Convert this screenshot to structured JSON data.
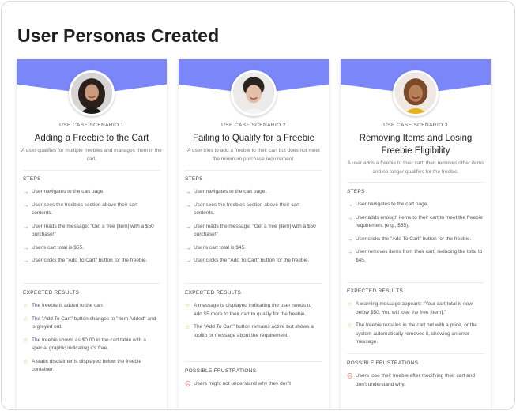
{
  "page": {
    "title": "User Personas Created"
  },
  "colors": {
    "banner": "#7b86f8",
    "step_arrow": "#3f8ee0",
    "star": "#f0b23c",
    "frustration": "#e05a4f"
  },
  "icons": {
    "step": "arrow-right-icon",
    "expected": "star-icon",
    "frustration": "sad-face-icon"
  },
  "cards": [
    {
      "label": "USE CASE SCENARIO 1",
      "title": "Adding a Freebie to the Cart",
      "description": "A user qualifies for multiple freebies and manages them in the cart.",
      "steps_heading": "STEPS",
      "steps": [
        "User navigates to the cart page.",
        "User sees the freebies section above their cart contents.",
        "User reads the message: \"Get a free [item] with a $50 purchase!\"",
        "User's cart total is $55.",
        "User clicks the \"Add To Cart\" button for the freebie."
      ],
      "expected_heading": "EXPECTED RESULTS",
      "expected": [
        "The freebie is added to the cart",
        "The \"Add To Cart\" button changes to \"Item Added\" and is greyed out.",
        "The freebie shows as $0.00 in the cart table with a special graphic indicating it's free.",
        "A static disclaimer is displayed below the freebie container."
      ]
    },
    {
      "label": "USE CASE SCENARIO 2",
      "title": "Failing to Qualify for a Freebie",
      "description": "A user tries to add a freebie to their cart but does not meet the minimum purchase requirement.",
      "steps_heading": "STEPS",
      "steps": [
        "User navigates to the cart page.",
        "User sees the freebies section above their cart contents.",
        "User reads the message: \"Get a free [item] with a $50 purchase!\"",
        "User's cart total is $45.",
        "User clicks the \"Add To Cart\" button for the freebie."
      ],
      "expected_heading": "EXPECTED RESULTS",
      "expected": [
        "A message is displayed indicating the user needs to add $5 more to their cart to qualify for the freebie.",
        "The \"Add To Cart\" button remains active but shows a tooltip or message about the requirement."
      ],
      "frustrations_heading": "POSSIBLE FRUSTRATIONS",
      "frustrations": [
        "Users might not understand why they don't"
      ]
    },
    {
      "label": "USE CASE SCENARIO 3",
      "title": "Removing Items and Losing Freebie Eligibility",
      "description": "A user adds a freebie to their cart, then removes other items and no longer qualifies for the freebie.",
      "steps_heading": "STEPS",
      "steps": [
        "User navigates to the cart page.",
        "User adds enough items to their cart to meet the freebie requirement (e.g., $55).",
        "User clicks the \"Add To Cart\" button for the freebie.",
        "User removes items from their cart, reducing the total to $45."
      ],
      "expected_heading": "EXPECTED RESULTS",
      "expected": [
        "A warning message appears: \"Your cart total is now below $50. You will lose the free [item].\"",
        "The freebie remains in the cart but with a price, or the system automatically removes it, showing an error message."
      ],
      "frustrations_heading": "POSSIBLE FRUSTRATIONS",
      "frustrations": [
        "Users lose their freebie after modifying their cart and don't understand why."
      ]
    }
  ]
}
